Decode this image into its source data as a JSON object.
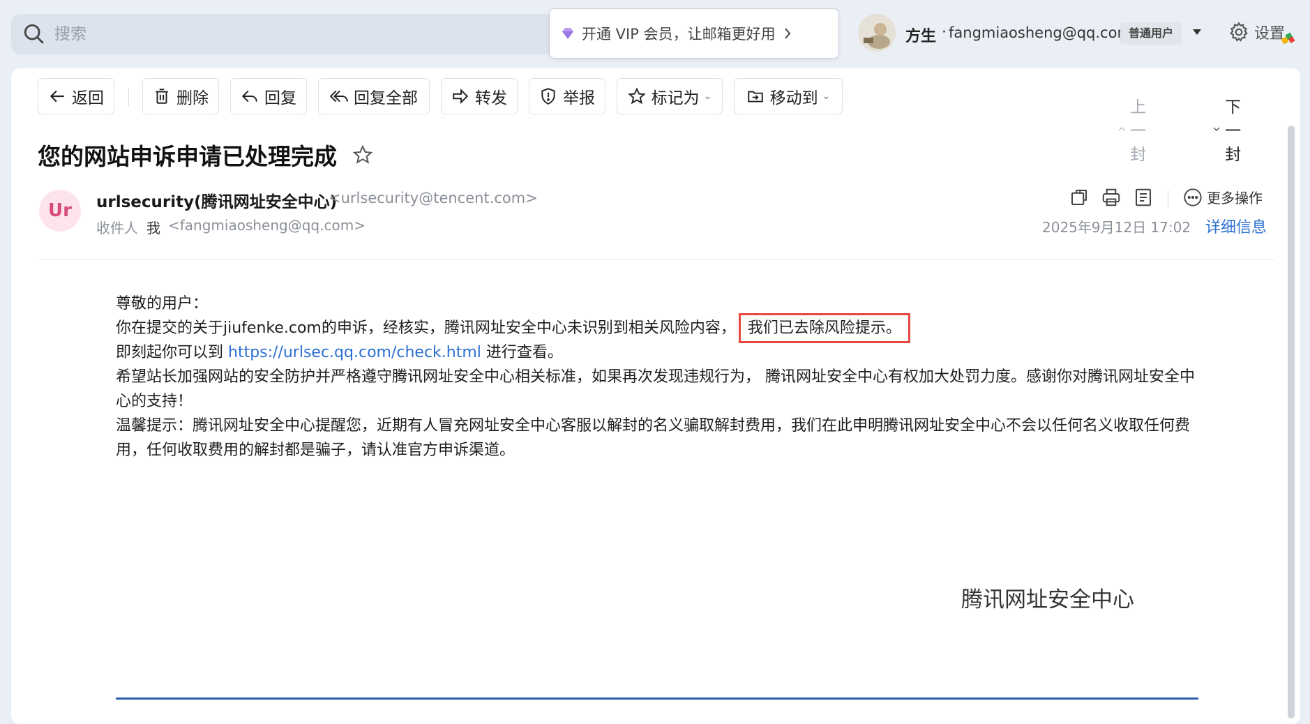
{
  "search": {
    "placeholder": "搜索"
  },
  "vip_banner": {
    "text": "开通 VIP 会员，让邮箱更好用"
  },
  "user": {
    "name": "方生",
    "separator": "·",
    "email": "fangmiaosheng@qq.com",
    "badge": "普通用户"
  },
  "settings": {
    "label": "设置"
  },
  "toolbar": {
    "back": "返回",
    "delete": "删除",
    "reply": "回复",
    "reply_all": "回复全部",
    "forward": "转发",
    "report": "举报",
    "mark_as": "标记为",
    "move_to": "移动到",
    "prev": "上一封",
    "next": "下一封"
  },
  "mail": {
    "subject": "您的网站申诉申请已处理完成",
    "sender_initials": "Ur",
    "sender_name": "urlsecurity(腾讯网址安全中心)",
    "sender_address": "<urlsecurity@tencent.com>",
    "recipient_label": "收件人",
    "recipient_name": "我",
    "recipient_address": "<fangmiaosheng@qq.com>",
    "more_actions": "更多操作",
    "date": "2025年9月12日 17:02",
    "details_link": "详细信息"
  },
  "body": {
    "greeting": "尊敬的用户：",
    "line1_prefix": "你在提交的关于jiufenke.com的申诉，经核实，腾讯网址安全中心未识别到相关风险内容，",
    "line1_highlight": "我们已去除风险提示。",
    "line2_prefix": "即刻起你可以到 ",
    "line2_link": "https://urlsec.qq.com/check.html",
    "line2_suffix": " 进行查看。",
    "line3": "希望站长加强网站的安全防护并严格遵守腾讯网址安全中心相关标准，如果再次发现违规行为， 腾讯网址安全中心有权加大处罚力度。感谢你对腾讯网址安全中心的支持！",
    "line4": "温馨提示：腾讯网址安全中心提醒您，近期有人冒充网址安全中心客服以解封的名义骗取解封费用，我们在此申明腾讯网址安全中心不会以任何名义收取任何费用，任何收取费用的解封都是骗子，请认准官方申诉渠道。",
    "signature": "腾讯网址安全中心"
  },
  "colors": {
    "link": "#2b6fd1",
    "highlight_border": "#e5483f",
    "sender_avatar_bg": "#fde4ec",
    "sender_avatar_text": "#d84b7c",
    "footer_line": "#2a5fa8"
  }
}
